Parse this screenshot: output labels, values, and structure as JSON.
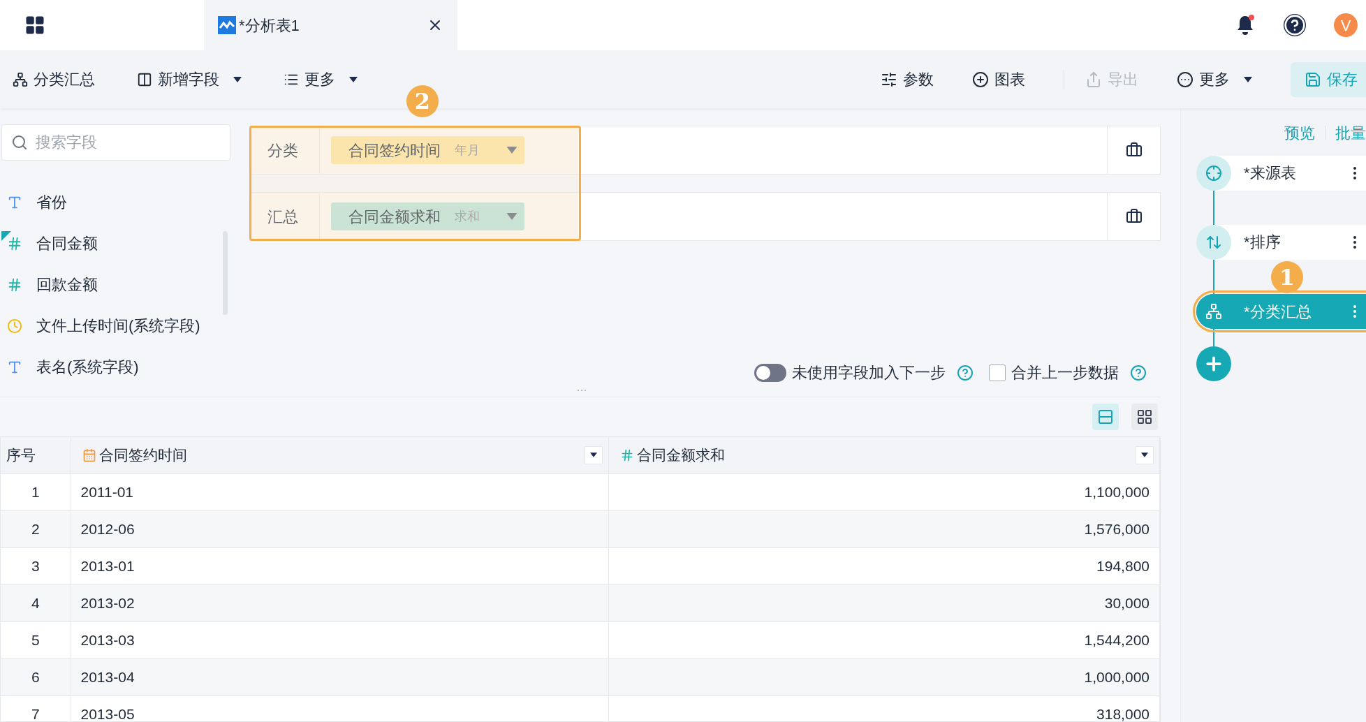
{
  "top_bar": {
    "tab": {
      "title": "*分析表1",
      "selected": true
    },
    "avatar": "V"
  },
  "toolbar": {
    "left": [
      {
        "label": "分类汇总",
        "kind": "title",
        "dropdown": false
      },
      {
        "label": "新增字段",
        "kind": "menu",
        "dropdown": true
      },
      {
        "label": "更多",
        "kind": "menu",
        "dropdown": true
      }
    ],
    "right": [
      {
        "label": "参数",
        "kind": "params",
        "dropdown": false,
        "disabled": false
      },
      {
        "label": "图表",
        "kind": "chart",
        "dropdown": false,
        "disabled": false
      },
      {
        "label": "导出",
        "kind": "export",
        "dropdown": false,
        "disabled": true
      },
      {
        "label": "更多",
        "kind": "more",
        "dropdown": true,
        "disabled": false
      },
      {
        "label": "保存",
        "kind": "save",
        "dropdown": false,
        "disabled": false
      }
    ]
  },
  "field_panel": {
    "search": {
      "placeholder": "搜索字段"
    },
    "fields": [
      {
        "name": "省份",
        "kind": "text",
        "marked": false
      },
      {
        "name": "合同金额",
        "kind": "number",
        "marked": true
      },
      {
        "name": "回款金额",
        "kind": "number",
        "marked": false
      },
      {
        "name": "文件上传时间(系统字段)",
        "kind": "time",
        "marked": false
      },
      {
        "name": "表名(系统字段)",
        "kind": "text",
        "marked": false
      }
    ]
  },
  "config": {
    "badge": "2",
    "rows": [
      {
        "label": "分类",
        "field": "合同签约时间",
        "mode": "年月",
        "kind": "dimension"
      },
      {
        "label": "汇总",
        "field": "合同金额求和",
        "mode": "求和",
        "kind": "measure"
      }
    ]
  },
  "options": [
    {
      "label": "未使用字段加入下一步",
      "kind": "toggle",
      "on": false
    },
    {
      "label": "合并上一步数据",
      "kind": "checkbox",
      "on": false
    }
  ],
  "view_modes": [
    {
      "kind": "list",
      "selected": true
    },
    {
      "kind": "grid",
      "selected": false
    }
  ],
  "table": {
    "columns": [
      {
        "label": "序号",
        "kind": "index"
      },
      {
        "label": "合同签约时间",
        "kind": "date"
      },
      {
        "label": "合同金额求和",
        "kind": "number"
      }
    ],
    "rows": [
      [
        "1",
        "2011-01",
        "1,100,000"
      ],
      [
        "2",
        "2012-06",
        "1,576,000"
      ],
      [
        "3",
        "2013-01",
        "194,800"
      ],
      [
        "4",
        "2013-02",
        "30,000"
      ],
      [
        "5",
        "2013-03",
        "1,544,200"
      ],
      [
        "6",
        "2013-04",
        "1,000,000"
      ],
      [
        "7",
        "2013-05",
        "318,000"
      ]
    ]
  },
  "flow": {
    "links": [
      "预览",
      "批量"
    ],
    "badge": "1",
    "steps": [
      {
        "name": "*来源表",
        "kind": "source",
        "selected": false
      },
      {
        "name": "*排序",
        "kind": "sort",
        "selected": false
      },
      {
        "name": "*分类汇总",
        "kind": "group",
        "selected": true
      }
    ]
  }
}
